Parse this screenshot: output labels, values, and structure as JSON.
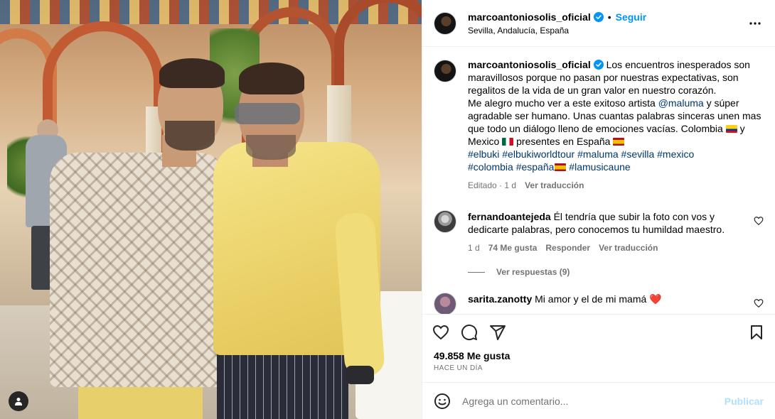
{
  "post": {
    "username": "marcoantoniosolis_oficial",
    "follow_label": "Seguir",
    "dot": "•",
    "location": "Sevilla, Andalucía, España",
    "more_icon": "more-horizontal-icon"
  },
  "caption": {
    "username": "marcoantoniosolis_oficial",
    "part1": "Los encuentros inesperados son maravillosos porque no pasan por nuestras expectativas, son regalitos de la vida de un gran valor en nuestro corazón.",
    "part2": "Me alegro mucho ver a este exitoso artista ",
    "mention": "@maluma",
    "part3": " y súper agradable ser humano. Unas cuantas palabras sinceras unen mas que todo un diálogo lleno de emociones vacías. Colombia ",
    "part4": " y Mexico ",
    "part5": " presentes en España ",
    "hashtags_line1": "#elbuki #elbukiworldtour #maluma #sevilla #mexico",
    "hashtags_line2a": "#colombia #españa",
    "hashtags_line2b": " #lamusicaune",
    "edited": "Editado",
    "dot": "·",
    "time": "1 d",
    "see_translation": "Ver traducción"
  },
  "comments": [
    {
      "username": "fernandoantejeda",
      "text": "Él tendría que subir la foto con vos y dedicarte palabras, pero conocemos tu humildad maestro.",
      "time": "1 d",
      "likes": "74 Me gusta",
      "reply": "Responder",
      "see_translation": "Ver traducción",
      "view_replies": "Ver respuestas (9)"
    },
    {
      "username": "sarita.zanotty",
      "text": "Mi amor y el de mi mamá ❤️"
    }
  ],
  "actions": {
    "like_icon": "heart-icon",
    "comment_icon": "comment-icon",
    "share_icon": "send-icon",
    "save_icon": "bookmark-icon"
  },
  "stats": {
    "likes": "49.858 Me gusta",
    "posted": "Hace un día"
  },
  "add_comment": {
    "placeholder": "Agrega un comentario...",
    "publish_label": "Publicar"
  },
  "colors": {
    "accent": "#0095f6",
    "link": "#00376b",
    "muted": "#737373",
    "publish_disabled": "#b2dffc",
    "heart": "#ed4956"
  }
}
